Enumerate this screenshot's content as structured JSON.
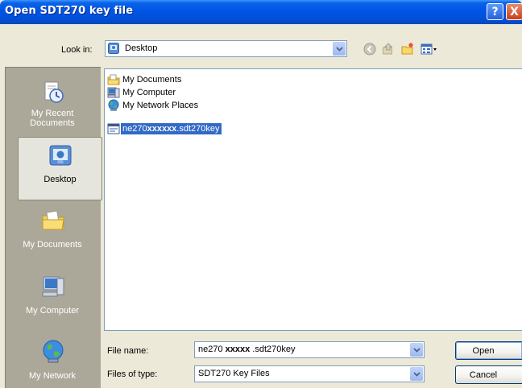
{
  "window": {
    "title": "Open SDT270 key file",
    "help_glyph": "?",
    "close_glyph": "X"
  },
  "lookin": {
    "label": "Look in:",
    "value": "Desktop",
    "icon": "desktop-icon"
  },
  "toolbar": {
    "icons": [
      "back-icon",
      "up-folder-icon",
      "new-folder-icon",
      "view-menu-icon"
    ]
  },
  "places": [
    {
      "name": "recent",
      "label_line1": "My Recent",
      "label_line2": "Documents",
      "icon": "recent-documents-icon",
      "selected": false
    },
    {
      "name": "desktop",
      "label_line1": "Desktop",
      "label_line2": "",
      "icon": "desktop-icon",
      "selected": true
    },
    {
      "name": "documents",
      "label_line1": "My Documents",
      "label_line2": "",
      "icon": "my-documents-icon",
      "selected": false
    },
    {
      "name": "computer",
      "label_line1": "My Computer",
      "label_line2": "",
      "icon": "my-computer-icon",
      "selected": false
    },
    {
      "name": "network",
      "label_line1": "My Network",
      "label_line2": "",
      "icon": "my-network-icon",
      "selected": false
    }
  ],
  "files": [
    {
      "name": "My Documents",
      "icon": "my-documents-folder-icon",
      "selected": false
    },
    {
      "name": "My Computer",
      "icon": "my-computer-icon",
      "selected": false
    },
    {
      "name": "My Network Places",
      "icon": "network-places-icon",
      "selected": false
    },
    {
      "name_prefix": "ne270",
      "name_bold": "xxxxxx",
      "name_suffix": ".sdt270key",
      "icon": "key-file-icon",
      "selected": true
    }
  ],
  "filename": {
    "label": "File name:",
    "value_prefix": "ne270 ",
    "value_bold": "xxxxx",
    "value_suffix": " .sdt270key"
  },
  "filetype": {
    "label": "Files of type:",
    "value": "SDT270 Key Files"
  },
  "buttons": {
    "open": "Open",
    "cancel": "Cancel"
  }
}
